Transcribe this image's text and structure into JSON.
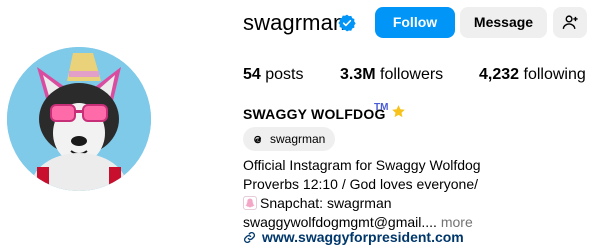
{
  "profile": {
    "username": "swagrman",
    "full_name": "SWAGGY WOLFDOG",
    "tm": "TM",
    "follow_label": "Follow",
    "message_label": "Message",
    "stats": {
      "posts_count": "54",
      "posts_label": "posts",
      "followers_count": "3.3M",
      "followers_label": "followers",
      "following_count": "4,232",
      "following_label": "following"
    },
    "threads_handle": "swagrman",
    "bio_lines": [
      "Official Instagram for Swaggy Wolfdog",
      "Proverbs 12:10 / God loves everyone/",
      "Snapchat: swagrman",
      "swaggywolfdogmgmt@gmail...."
    ],
    "more_label": "more",
    "link": "www.swaggyforpresident.com"
  },
  "colors": {
    "follow_bg": "#0095f6",
    "verified": "#0095f6",
    "link": "#00376b",
    "secondary_btn": "#efefef"
  },
  "icons": [
    "verified-badge-icon",
    "add-user-icon",
    "star-icon",
    "threads-icon",
    "snapchat-ghost-icon",
    "link-icon"
  ]
}
